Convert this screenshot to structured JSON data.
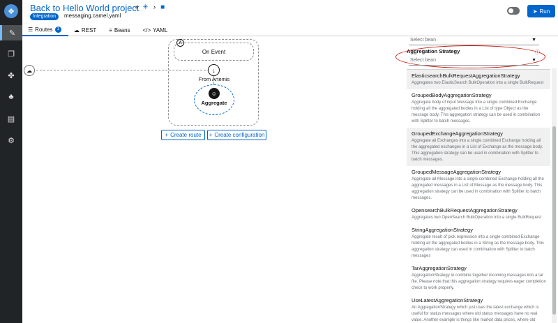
{
  "header": {
    "title": "Back to Hello World project",
    "badge": "Integration",
    "filename": "messaging.camel.yaml",
    "run_label": "Run"
  },
  "sidebar": {
    "items": [
      {
        "icon": "routes-icon"
      },
      {
        "icon": "copy-icon"
      },
      {
        "icon": "integration-icon"
      },
      {
        "icon": "components-icon"
      },
      {
        "icon": "docs-icon"
      },
      {
        "icon": "settings-icon"
      }
    ]
  },
  "tabs": [
    {
      "label": "Routes",
      "count": "1",
      "icon": "routes-tab-icon"
    },
    {
      "label": "REST",
      "icon": "cloud-icon"
    },
    {
      "label": "Beans",
      "icon": "beans-icon"
    },
    {
      "label": "YAML",
      "icon": "code-icon"
    }
  ],
  "canvas": {
    "group_marker": "A",
    "on_event": "On Event",
    "from_label": "From Artemis",
    "aggregate_label": "Aggregate",
    "create_route": "Create route",
    "create_configuration": "Create configuration"
  },
  "panel": {
    "top_select_placeholder": "Select bean",
    "aggregation_label": "Aggregation Strategy",
    "aggregation_placeholder": "Select bean",
    "items": [
      {
        "name": "ElasticsearchBulkRequestAggregationStrategy",
        "desc": "Aggregates two ElasticSearch BulkOperation into a single BulkRequest"
      },
      {
        "name": "GroupedBodyAggregationStrategy",
        "desc": "Aggregate body of input Message into a single combined Exchange holding all the aggregated bodies in a List of type Object as the message body. This aggregation strategy can be used in combination with Splitter to batch messages."
      },
      {
        "name": "GroupedExchangeAggregationStrategy",
        "desc": "Aggregate all Exchanges into a single combined Exchange holding all the aggregated exchanges in a List of Exchange as the message body. This aggregation strategy can be used in combination with Splitter to batch messages."
      },
      {
        "name": "GroupedMessageAggregationStrategy",
        "desc": "Aggregate all Message into a single combined Exchange holding all the aggregated messages in a List of Message as the message body. This aggregation strategy can be used in combination with Splitter to batch messages."
      },
      {
        "name": "OpensearchBulkRequestAggregationStrategy",
        "desc": "Aggregates two OpenSearch BulkOperation into a single BulkRequest"
      },
      {
        "name": "StringAggregationStrategy",
        "desc": "Aggregate result of pick expression into a single combined Exchange holding all the aggregated bodies in a String as the message body. This aggregation strategy can used in combination with Splitter to batch messages"
      },
      {
        "name": "TarAggregationStrategy",
        "desc": "AggregationStrategy to combine together incoming messages into a tar file. Please note that this aggregation strategy requires eager completion check to work properly."
      },
      {
        "name": "UseLatestAggregationStrategy",
        "desc": "An AggregationStrategy which just uses the latest exchange which is useful for status messages where old status messages have no real value. Another example is things like market data prices, where old stock prices are not that relevant, only the current price is."
      }
    ]
  }
}
